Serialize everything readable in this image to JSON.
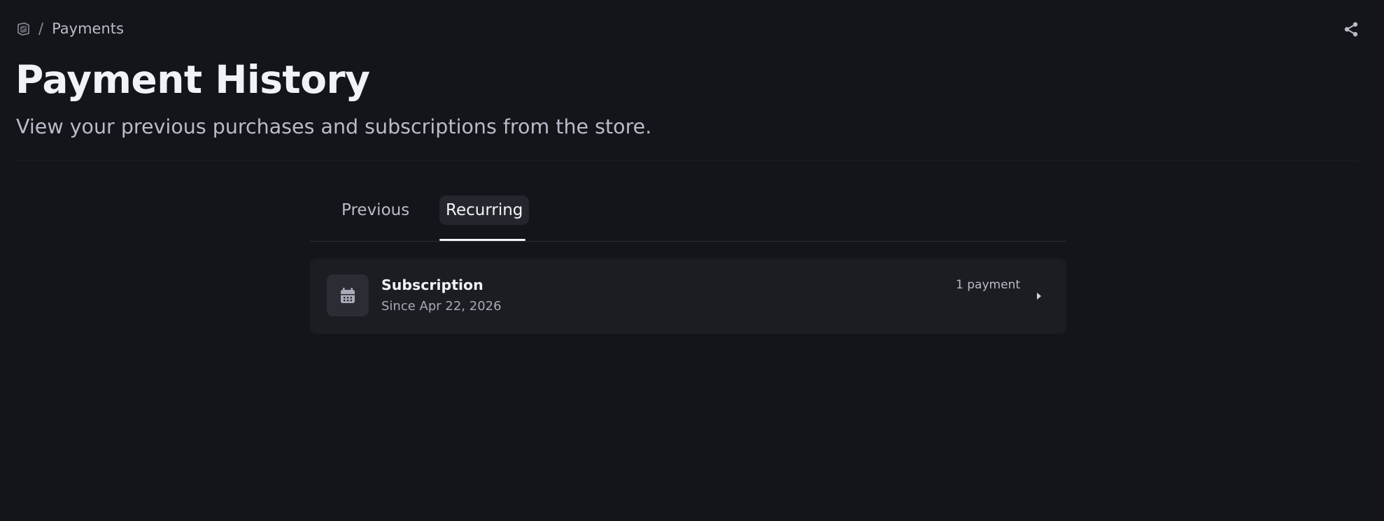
{
  "breadcrumb": {
    "home_icon": "home-logo-icon",
    "separator": "/",
    "current": "Payments"
  },
  "header": {
    "title": "Payment History",
    "subtitle": "View your previous purchases and subscriptions from the store.",
    "share_icon": "share-icon"
  },
  "tabs": [
    {
      "label": "Previous",
      "active": false
    },
    {
      "label": "Recurring",
      "active": true
    }
  ],
  "subscription": {
    "icon": "calendar-icon",
    "title": "Subscription",
    "since": "Since Apr 22, 2026",
    "count": "1 payment",
    "chevron_icon": "chevron-right-icon"
  },
  "colors": {
    "background": "#14151a",
    "card": "#1c1d22",
    "active_tab_bg": "#25262d",
    "text_primary": "#f1f2f5",
    "text_secondary": "#b9bcc9"
  }
}
